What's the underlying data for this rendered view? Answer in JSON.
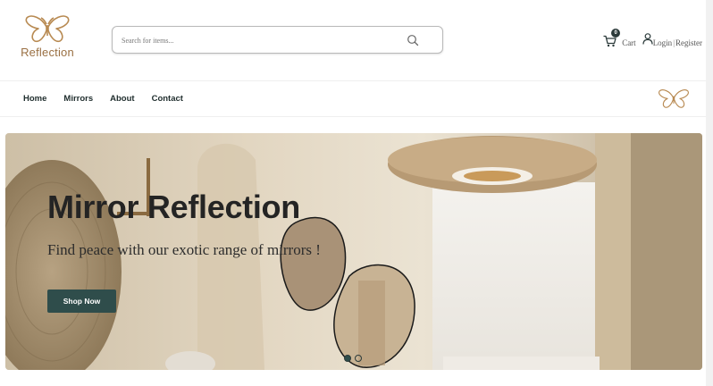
{
  "brand": {
    "name": "Reflection",
    "color": "#9a7043"
  },
  "search": {
    "placeholder": "Search for items...",
    "icon": "search-icon"
  },
  "account": {
    "cart_count": "0",
    "cart_label": "Cart",
    "login_label": "Login",
    "separator": "|",
    "register_label": "Register"
  },
  "nav": {
    "items": [
      {
        "label": "Home"
      },
      {
        "label": "Mirrors"
      },
      {
        "label": "About"
      },
      {
        "label": "Contact"
      }
    ]
  },
  "hero": {
    "title": "Mirror Reflection",
    "subtitle": "Find peace with our exotic range of mirrors !",
    "cta_label": "Shop Now",
    "cta_color": "#2f4d4b",
    "slides": [
      {
        "active": true
      },
      {
        "active": false
      }
    ]
  }
}
